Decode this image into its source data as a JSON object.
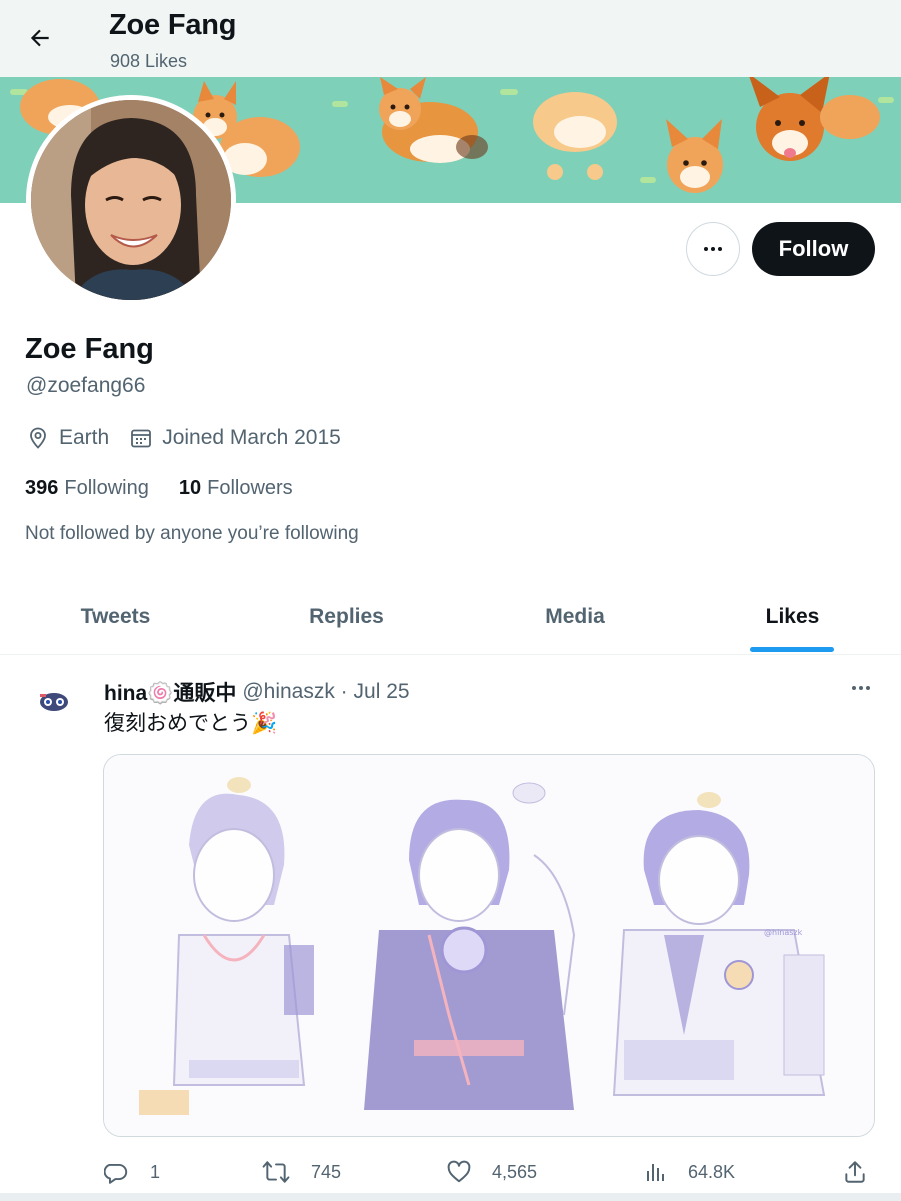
{
  "header": {
    "name": "Zoe Fang",
    "count": "908 Likes"
  },
  "profile": {
    "name": "Zoe Fang",
    "handle": "@zoefang66",
    "location": "Earth",
    "joined": "Joined March 2015",
    "following_count": "396",
    "following_label": "Following",
    "followers_count": "10",
    "followers_label": "Followers",
    "not_followed_text": "Not followed by anyone you’re following",
    "follow_button": "Follow"
  },
  "tabs": [
    {
      "label": "Tweets",
      "active": false
    },
    {
      "label": "Replies",
      "active": false
    },
    {
      "label": "Media",
      "active": false
    },
    {
      "label": "Likes",
      "active": true
    }
  ],
  "tweet": {
    "author": "hina🍥通販中",
    "handle_date": "@hinaszk · Jul 25",
    "text": "復刻おめでとう🎉",
    "actions": {
      "reply": "1",
      "retweet": "745",
      "like": "4,565",
      "views": "64.8K"
    }
  },
  "colors": {
    "accent": "#1d9bf0",
    "text_primary": "#0f1419",
    "text_secondary": "#536471",
    "follow_button_bg": "#0f1419",
    "banner_bg": "#7fd0b8"
  },
  "icons": {
    "back": "arrow-left-icon",
    "more": "more-horizontal-icon",
    "location": "location-pin-icon",
    "calendar": "calendar-icon",
    "reply": "reply-icon",
    "retweet": "retweet-icon",
    "like": "heart-icon",
    "views": "views-bar-chart-icon",
    "share": "share-icon"
  }
}
